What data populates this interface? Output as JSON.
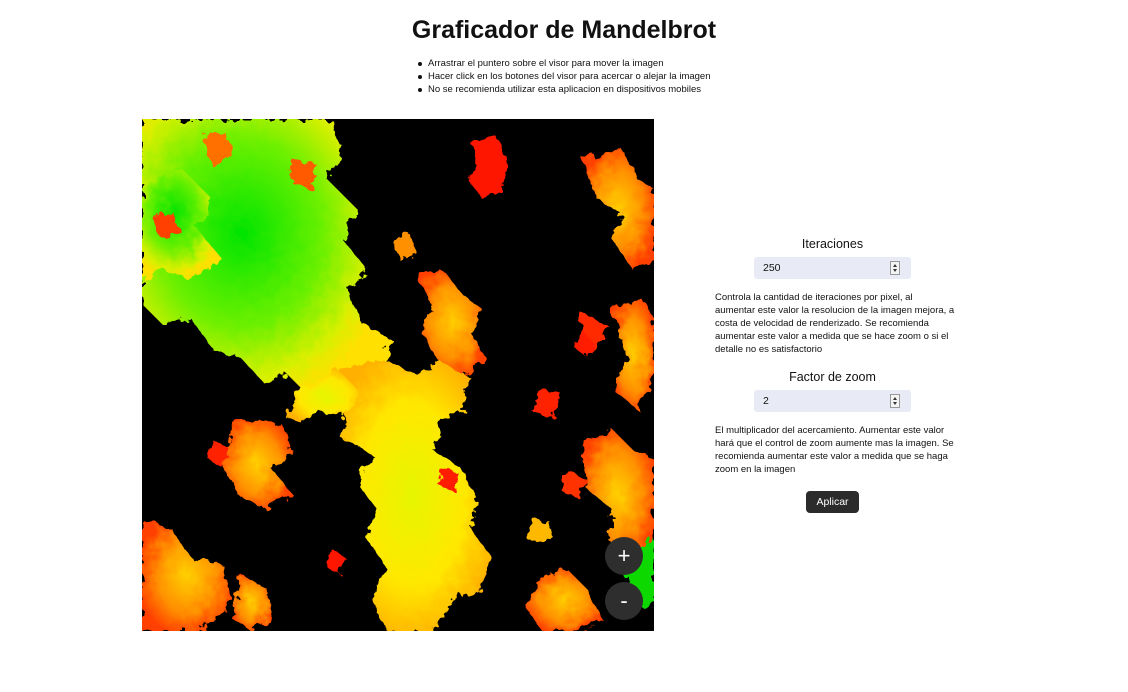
{
  "title": "Graficador de Mandelbrot",
  "instructions": [
    "Arrastrar el puntero sobre el visor para mover la imagen",
    "Hacer click en los botones del visor para acercar o alejar la imagen",
    "No se recomienda utilizar esta aplicacion en dispositivos mobiles"
  ],
  "viewer": {
    "zoom_in_label": "+",
    "zoom_out_label": "-"
  },
  "iterations": {
    "label": "Iteraciones",
    "value": "250",
    "description": "Controla la cantidad de iteraciones por pixel, al aumentar este valor la resolucion de la imagen mejora, a costa de velocidad de renderizado. Se recomienda aumentar este valor a medida que se hace zoom o si el detalle no es satisfactorio"
  },
  "zoom_factor": {
    "label": "Factor de zoom",
    "value": "2",
    "description": "El multiplicador del acercamiento. Aumentar este valor hará que el control de zoom aumente mas la imagen. Se recomienda aumentar este valor a medida que se haga zoom en la imagen"
  },
  "apply_label": "Aplicar",
  "colors": {
    "background": "#000000",
    "green": "#00e000",
    "yellow": "#ffee00",
    "orange": "#ff8c00",
    "red": "#ff1500",
    "button_dark": "#2e2e2e",
    "input_bg": "#e8ebf5"
  }
}
